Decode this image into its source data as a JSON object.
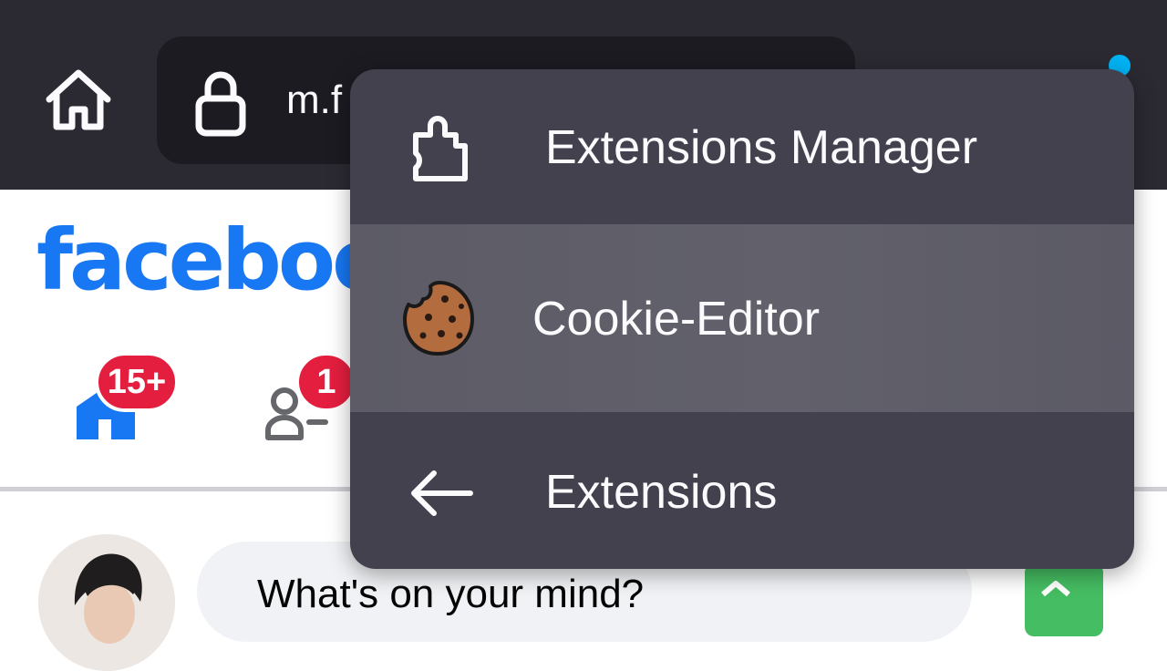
{
  "browser": {
    "url_text": "m.f",
    "icons": {
      "home": "home-icon",
      "lock": "lock-icon"
    },
    "colors": {
      "toolbar": "#2b2a33",
      "urlbar": "#1c1b22",
      "extension_dot": "#00b3f4"
    }
  },
  "facebook": {
    "logo": "faceboo",
    "badges": {
      "home": "15+",
      "friends": "1"
    },
    "composer_placeholder": "What's on your mind?",
    "colors": {
      "brand": "#1877f2",
      "badge": "#e41e3f"
    }
  },
  "extensions_menu": {
    "items": [
      {
        "label": "Extensions Manager",
        "icon": "puzzle-piece-icon"
      },
      {
        "label": "Cookie-Editor",
        "icon": "cookie-icon",
        "highlighted": true
      },
      {
        "label": "Extensions",
        "icon": "arrow-left-icon"
      }
    ],
    "colors": {
      "background": "#42414d",
      "highlight": "#5c5b66",
      "text": "#fbfbfe"
    }
  }
}
